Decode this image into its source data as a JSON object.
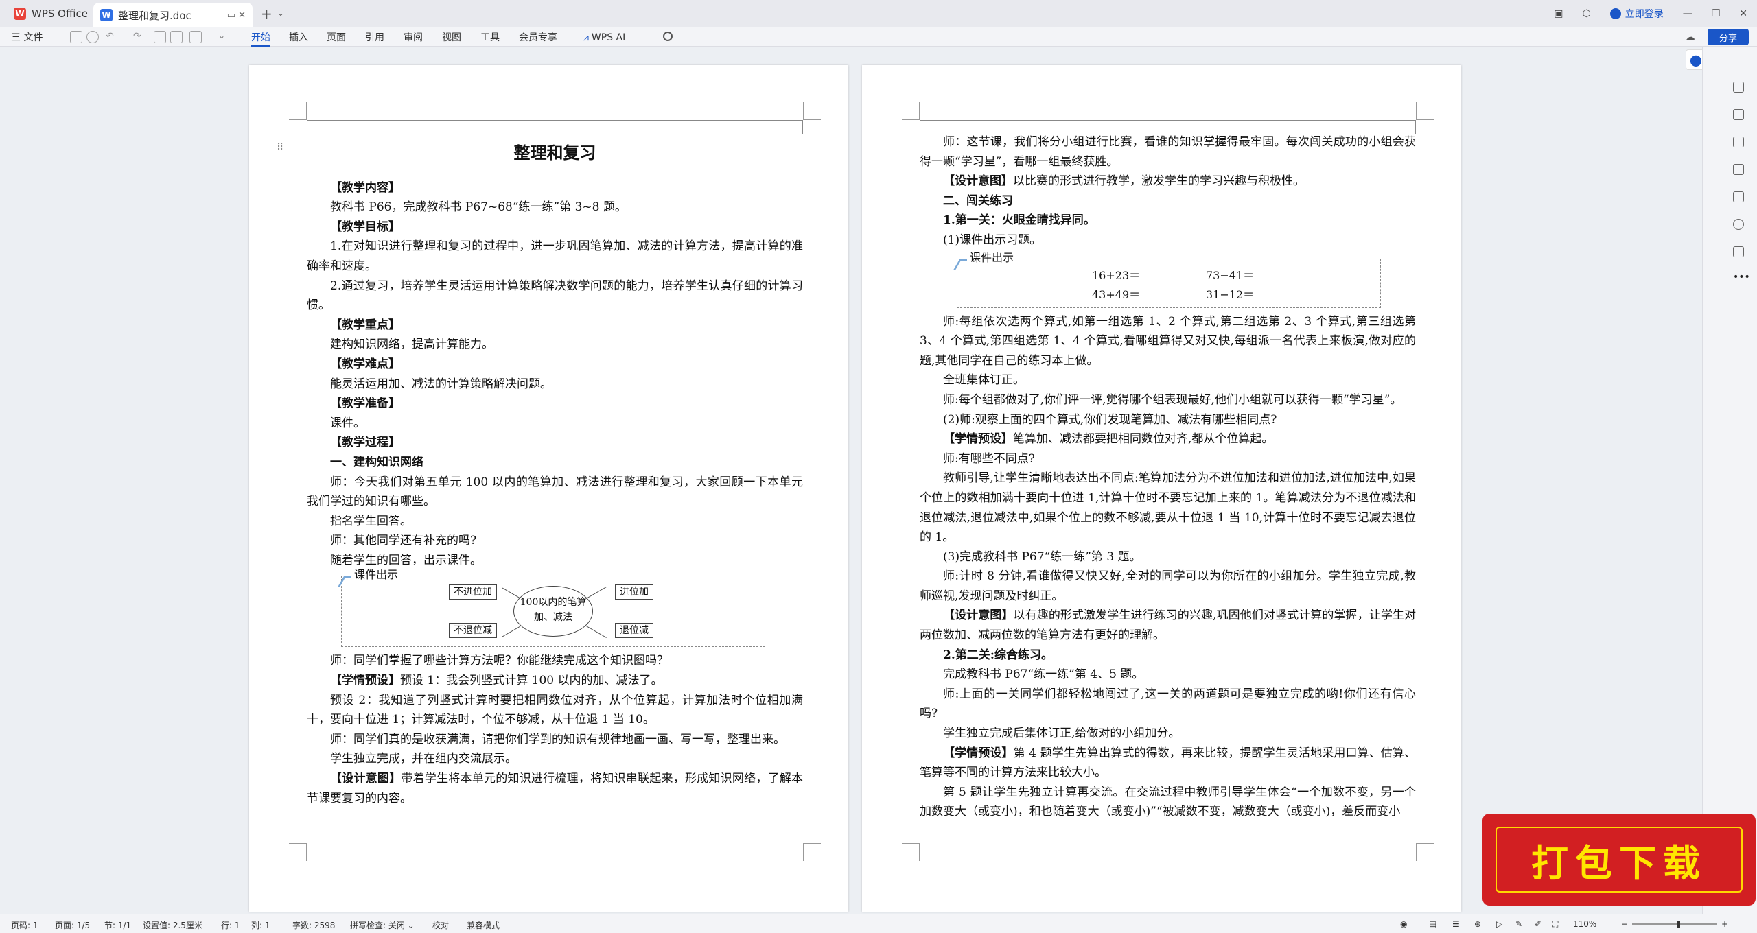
{
  "titlebar": {
    "home_tab": "WPS Office",
    "doc_tab": "整理和复习.doc",
    "login": "立即登录"
  },
  "ribbon": {
    "file_menu": "三 文件",
    "tabs": [
      "开始",
      "插入",
      "页面",
      "引用",
      "审阅",
      "视图",
      "工具",
      "会员专享"
    ],
    "active_tab": "开始",
    "wps_ai": "WPS AI",
    "share": "分享"
  },
  "page1": {
    "title": "整理和复习",
    "paras": {
      "p1": "【教学内容】",
      "p2": "教科书 P66，完成教科书 P67~68“练一练”第 3~8 题。",
      "p3": "【教学目标】",
      "p4": "1.在对知识进行整理和复习的过程中，进一步巩固笔算加、减法的计算方法，提高计算的准确率和速度。",
      "p5": "2.通过复习，培养学生灵活运用计算策略解决数学问题的能力，培养学生认真仔细的计算习惯。",
      "p6": "【教学重点】",
      "p7": "建构知识网络，提高计算能力。",
      "p8": "【教学难点】",
      "p9": "能灵活运用加、减法的计算策略解决问题。",
      "p10": "【教学准备】",
      "p11": "课件。",
      "p12": "【教学过程】",
      "p13": "一、建构知识网络",
      "p14": "师：今天我们对第五单元 100 以内的笔算加、减法进行整理和复习，大家回顾一下本单元我们学过的知识有哪些。",
      "p15": "指名学生回答。",
      "p16": "师：其他同学还有补充的吗?",
      "p17": "随着学生的回答，出示课件。",
      "p18": "师：同学们掌握了哪些计算方法呢？你能继续完成这个知识图吗？",
      "p19_b": "【学情预设】",
      "p19": "预设 1：我会列竖式计算 100 以内的加、减法了。",
      "p20": "预设 2：我知道了列竖式计算时要把相同数位对齐，从个位算起，计算加法时个位相加满十，要向十位进 1；计算减法时，个位不够减，从十位退 1 当 10。",
      "p21": "师：同学们真的是收获满满，请把你们学到的知识有规律地画一画、写一写，整理出来。",
      "p22": "学生独立完成，并在组内交流展示。",
      "p23_b": "【设计意图】",
      "p23": "带着学生将本单元的知识进行梳理，将知识串联起来，形成知识网络，了解本节课要复习的内容。"
    },
    "slide": {
      "title": "课件出示",
      "center": "100以内的笔算加、减法",
      "tl": "不进位加",
      "bl": "不退位减",
      "tr": "进位加",
      "br": "退位减"
    }
  },
  "page2": {
    "paras": {
      "q1": "师：这节课，我们将分小组进行比赛，看谁的知识掌握得最牢固。每次闯关成功的小组会获得一颗“学习星”，看哪一组最终获胜。",
      "q2_b": "【设计意图】",
      "q2": "以比赛的形式进行教学，激发学生的学习兴趣与积极性。",
      "q3": "二、闯关练习",
      "q4": "1.第一关：火眼金睛找异同。",
      "q5": "(1)课件出示习题。",
      "q6": "师:每组依次选两个算式,如第一组选第 1、2 个算式,第二组选第 2、3 个算式,第三组选第 3、4 个算式,第四组选第 1、4 个算式,看哪组算得又对又快,每组派一名代表上来板演,做对应的题,其他同学在自己的练习本上做。",
      "q7": "全班集体订正。",
      "q8": "师:每个组都做对了,你们评一评,觉得哪个组表现最好,他们小组就可以获得一颗“学习星”。",
      "q9": "(2)师:观察上面的四个算式,你们发现笔算加、减法有哪些相同点?",
      "q10_b": "【学情预设】",
      "q10": "笔算加、减法都要把相同数位对齐,都从个位算起。",
      "q11": "师:有哪些不同点?",
      "q12": "教师引导,让学生清晰地表达出不同点:笔算加法分为不进位加法和进位加法,进位加法中,如果个位上的数相加满十要向十位进 1,计算十位时不要忘记加上来的 1。笔算减法分为不退位减法和退位减法,退位减法中,如果个位上的数不够减,要从十位退 1 当 10,计算十位时不要忘记减去退位的 1。",
      "q13": "(3)完成教科书 P67“练一练”第 3 题。",
      "q14": "师:计时 8 分钟,看谁做得又快又好,全对的同学可以为你所在的小组加分。学生独立完成,教师巡视,发现问题及时纠正。",
      "q15_b": "【设计意图】",
      "q15": "以有趣的形式激发学生进行练习的兴趣,巩固他们对竖式计算的掌握，让学生对两位数加、减两位数的笔算方法有更好的理解。",
      "q16": "2.第二关:综合练习。",
      "q17": "完成教科书 P67“练一练”第 4、5 题。",
      "q18": "师:上面的一关同学们都轻松地闯过了,这一关的两道题可是要独立完成的哟!你们还有信心吗?",
      "q19": "学生独立完成后集体订正,给做对的小组加分。",
      "q20_b": "【学情预设】",
      "q20": "第 4 题学生先算出算式的得数，再来比较，提醒学生灵活地采用口算、估算、笔算等不同的计算方法来比较大小。",
      "q21": "第 5 题让学生先独立计算再交流。在交流过程中教师引导学生体会“一个加数不变，另一个加数变大（或变小)，和也随着变大（或变小)”“被减数不变，减数变大（或变小)，差反而变小"
    },
    "slide": {
      "title": "课件出示",
      "e1": "16+23＝",
      "e2": "73−41＝",
      "e3": "43+49＝",
      "e4": "31−12＝"
    }
  },
  "statusbar": {
    "row": "页码: 1",
    "pages": "页面: 1/5",
    "section": "节: 1/1",
    "setting": "设置值: 2.5厘米",
    "line": "行: 1",
    "col": "列: 1",
    "words": "字数: 2598",
    "spell": "拼写检查: 关闭 ⌄",
    "proof": "校对",
    "compat": "兼容模式",
    "zoom": "110%",
    "zoom_level": 0.55
  },
  "banner": {
    "text": "打包下载"
  }
}
